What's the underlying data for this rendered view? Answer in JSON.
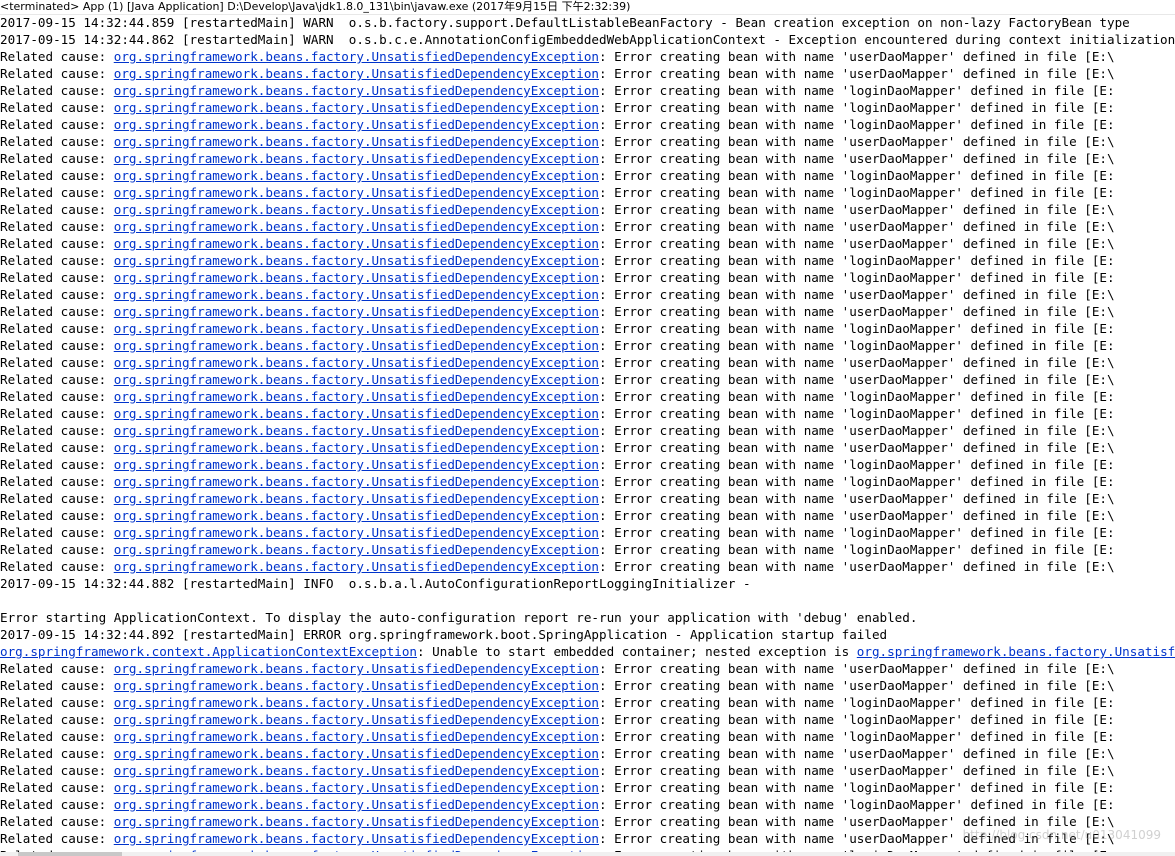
{
  "header": {
    "text": "<terminated> App (1) [Java Application] D:\\Develop\\Java\\jdk1.8.0_131\\bin\\javaw.exe (2017年9月15日 下午2:32:39)"
  },
  "link_color": "#0033cc",
  "lines": [
    {
      "text": "2017-09-15 14:32:44.859 [restartedMain] WARN  o.s.b.factory.support.DefaultListableBeanFactory - Bean creation exception on non-lazy FactoryBean type"
    },
    {
      "text": "2017-09-15 14:32:44.862 [restartedMain] WARN  o.s.b.c.e.AnnotationConfigEmbeddedWebApplicationContext - Exception encountered during context initialization"
    },
    {
      "pre": "Related cause: ",
      "link": "org.springframework.beans.factory.UnsatisfiedDependencyException",
      "text": ": Error creating bean with name 'userDaoMapper' defined in file [E:\\"
    },
    {
      "pre": "Related cause: ",
      "link": "org.springframework.beans.factory.UnsatisfiedDependencyException",
      "text": ": Error creating bean with name 'userDaoMapper' defined in file [E:\\"
    },
    {
      "pre": "Related cause: ",
      "link": "org.springframework.beans.factory.UnsatisfiedDependencyException",
      "text": ": Error creating bean with name 'loginDaoMapper' defined in file [E:"
    },
    {
      "pre": "Related cause: ",
      "link": "org.springframework.beans.factory.UnsatisfiedDependencyException",
      "text": ": Error creating bean with name 'loginDaoMapper' defined in file [E:"
    },
    {
      "pre": "Related cause: ",
      "link": "org.springframework.beans.factory.UnsatisfiedDependencyException",
      "text": ": Error creating bean with name 'loginDaoMapper' defined in file [E:"
    },
    {
      "pre": "Related cause: ",
      "link": "org.springframework.beans.factory.UnsatisfiedDependencyException",
      "text": ": Error creating bean with name 'userDaoMapper' defined in file [E:\\"
    },
    {
      "pre": "Related cause: ",
      "link": "org.springframework.beans.factory.UnsatisfiedDependencyException",
      "text": ": Error creating bean with name 'userDaoMapper' defined in file [E:\\"
    },
    {
      "pre": "Related cause: ",
      "link": "org.springframework.beans.factory.UnsatisfiedDependencyException",
      "text": ": Error creating bean with name 'loginDaoMapper' defined in file [E:"
    },
    {
      "pre": "Related cause: ",
      "link": "org.springframework.beans.factory.UnsatisfiedDependencyException",
      "text": ": Error creating bean with name 'loginDaoMapper' defined in file [E:"
    },
    {
      "pre": "Related cause: ",
      "link": "org.springframework.beans.factory.UnsatisfiedDependencyException",
      "text": ": Error creating bean with name 'userDaoMapper' defined in file [E:\\"
    },
    {
      "pre": "Related cause: ",
      "link": "org.springframework.beans.factory.UnsatisfiedDependencyException",
      "text": ": Error creating bean with name 'userDaoMapper' defined in file [E:\\"
    },
    {
      "pre": "Related cause: ",
      "link": "org.springframework.beans.factory.UnsatisfiedDependencyException",
      "text": ": Error creating bean with name 'userDaoMapper' defined in file [E:\\"
    },
    {
      "pre": "Related cause: ",
      "link": "org.springframework.beans.factory.UnsatisfiedDependencyException",
      "text": ": Error creating bean with name 'loginDaoMapper' defined in file [E:"
    },
    {
      "pre": "Related cause: ",
      "link": "org.springframework.beans.factory.UnsatisfiedDependencyException",
      "text": ": Error creating bean with name 'loginDaoMapper' defined in file [E:"
    },
    {
      "pre": "Related cause: ",
      "link": "org.springframework.beans.factory.UnsatisfiedDependencyException",
      "text": ": Error creating bean with name 'userDaoMapper' defined in file [E:\\"
    },
    {
      "pre": "Related cause: ",
      "link": "org.springframework.beans.factory.UnsatisfiedDependencyException",
      "text": ": Error creating bean with name 'userDaoMapper' defined in file [E:\\"
    },
    {
      "pre": "Related cause: ",
      "link": "org.springframework.beans.factory.UnsatisfiedDependencyException",
      "text": ": Error creating bean with name 'loginDaoMapper' defined in file [E:"
    },
    {
      "pre": "Related cause: ",
      "link": "org.springframework.beans.factory.UnsatisfiedDependencyException",
      "text": ": Error creating bean with name 'loginDaoMapper' defined in file [E:"
    },
    {
      "pre": "Related cause: ",
      "link": "org.springframework.beans.factory.UnsatisfiedDependencyException",
      "text": ": Error creating bean with name 'userDaoMapper' defined in file [E:\\"
    },
    {
      "pre": "Related cause: ",
      "link": "org.springframework.beans.factory.UnsatisfiedDependencyException",
      "text": ": Error creating bean with name 'userDaoMapper' defined in file [E:\\"
    },
    {
      "pre": "Related cause: ",
      "link": "org.springframework.beans.factory.UnsatisfiedDependencyException",
      "text": ": Error creating bean with name 'loginDaoMapper' defined in file [E:"
    },
    {
      "pre": "Related cause: ",
      "link": "org.springframework.beans.factory.UnsatisfiedDependencyException",
      "text": ": Error creating bean with name 'loginDaoMapper' defined in file [E:"
    },
    {
      "pre": "Related cause: ",
      "link": "org.springframework.beans.factory.UnsatisfiedDependencyException",
      "text": ": Error creating bean with name 'userDaoMapper' defined in file [E:\\"
    },
    {
      "pre": "Related cause: ",
      "link": "org.springframework.beans.factory.UnsatisfiedDependencyException",
      "text": ": Error creating bean with name 'userDaoMapper' defined in file [E:\\"
    },
    {
      "pre": "Related cause: ",
      "link": "org.springframework.beans.factory.UnsatisfiedDependencyException",
      "text": ": Error creating bean with name 'loginDaoMapper' defined in file [E:"
    },
    {
      "pre": "Related cause: ",
      "link": "org.springframework.beans.factory.UnsatisfiedDependencyException",
      "text": ": Error creating bean with name 'loginDaoMapper' defined in file [E:"
    },
    {
      "pre": "Related cause: ",
      "link": "org.springframework.beans.factory.UnsatisfiedDependencyException",
      "text": ": Error creating bean with name 'userDaoMapper' defined in file [E:\\"
    },
    {
      "pre": "Related cause: ",
      "link": "org.springframework.beans.factory.UnsatisfiedDependencyException",
      "text": ": Error creating bean with name 'userDaoMapper' defined in file [E:\\"
    },
    {
      "pre": "Related cause: ",
      "link": "org.springframework.beans.factory.UnsatisfiedDependencyException",
      "text": ": Error creating bean with name 'loginDaoMapper' defined in file [E:"
    },
    {
      "pre": "Related cause: ",
      "link": "org.springframework.beans.factory.UnsatisfiedDependencyException",
      "text": ": Error creating bean with name 'loginDaoMapper' defined in file [E:"
    },
    {
      "pre": "Related cause: ",
      "link": "org.springframework.beans.factory.UnsatisfiedDependencyException",
      "text": ": Error creating bean with name 'userDaoMapper' defined in file [E:\\"
    },
    {
      "text": "2017-09-15 14:32:44.882 [restartedMain] INFO  o.s.b.a.l.AutoConfigurationReportLoggingInitializer -"
    },
    {
      "text": ""
    },
    {
      "text": "Error starting ApplicationContext. To display the auto-configuration report re-run your application with 'debug' enabled."
    },
    {
      "text": "2017-09-15 14:32:44.892 [restartedMain] ERROR org.springframework.boot.SpringApplication - Application startup failed"
    },
    {
      "link": "org.springframework.context.ApplicationContextException",
      "text": ": Unable to start embedded container; nested exception is ",
      "link2": "org.springframework.beans.factory.UnsatisfiedDependencyException"
    },
    {
      "pre": "Related cause: ",
      "link": "org.springframework.beans.factory.UnsatisfiedDependencyException",
      "text": ": Error creating bean with name 'userDaoMapper' defined in file [E:\\"
    },
    {
      "pre": "Related cause: ",
      "link": "org.springframework.beans.factory.UnsatisfiedDependencyException",
      "text": ": Error creating bean with name 'userDaoMapper' defined in file [E:\\"
    },
    {
      "pre": "Related cause: ",
      "link": "org.springframework.beans.factory.UnsatisfiedDependencyException",
      "text": ": Error creating bean with name 'loginDaoMapper' defined in file [E:"
    },
    {
      "pre": "Related cause: ",
      "link": "org.springframework.beans.factory.UnsatisfiedDependencyException",
      "text": ": Error creating bean with name 'loginDaoMapper' defined in file [E:"
    },
    {
      "pre": "Related cause: ",
      "link": "org.springframework.beans.factory.UnsatisfiedDependencyException",
      "text": ": Error creating bean with name 'loginDaoMapper' defined in file [E:"
    },
    {
      "pre": "Related cause: ",
      "link": "org.springframework.beans.factory.UnsatisfiedDependencyException",
      "text": ": Error creating bean with name 'userDaoMapper' defined in file [E:\\"
    },
    {
      "pre": "Related cause: ",
      "link": "org.springframework.beans.factory.UnsatisfiedDependencyException",
      "text": ": Error creating bean with name 'userDaoMapper' defined in file [E:\\"
    },
    {
      "pre": "Related cause: ",
      "link": "org.springframework.beans.factory.UnsatisfiedDependencyException",
      "text": ": Error creating bean with name 'loginDaoMapper' defined in file [E:"
    },
    {
      "pre": "Related cause: ",
      "link": "org.springframework.beans.factory.UnsatisfiedDependencyException",
      "text": ": Error creating bean with name 'loginDaoMapper' defined in file [E:"
    },
    {
      "pre": "Related cause: ",
      "link": "org.springframework.beans.factory.UnsatisfiedDependencyException",
      "text": ": Error creating bean with name 'userDaoMapper' defined in file [E:\\"
    },
    {
      "pre": "Related cause: ",
      "link": "org.springframework.beans.factory.UnsatisfiedDependencyException",
      "text": ": Error creating bean with name 'userDaoMapper' defined in file [E:\\"
    },
    {
      "pre": "Related cause: ",
      "link": "org.springframework.beans.factory.UnsatisfiedDependencyException",
      "text": ": Error creating bean with name 'loginDaoMapper' defined in file [E:"
    }
  ],
  "watermark": "http://blog.csdn.net/u013041099"
}
